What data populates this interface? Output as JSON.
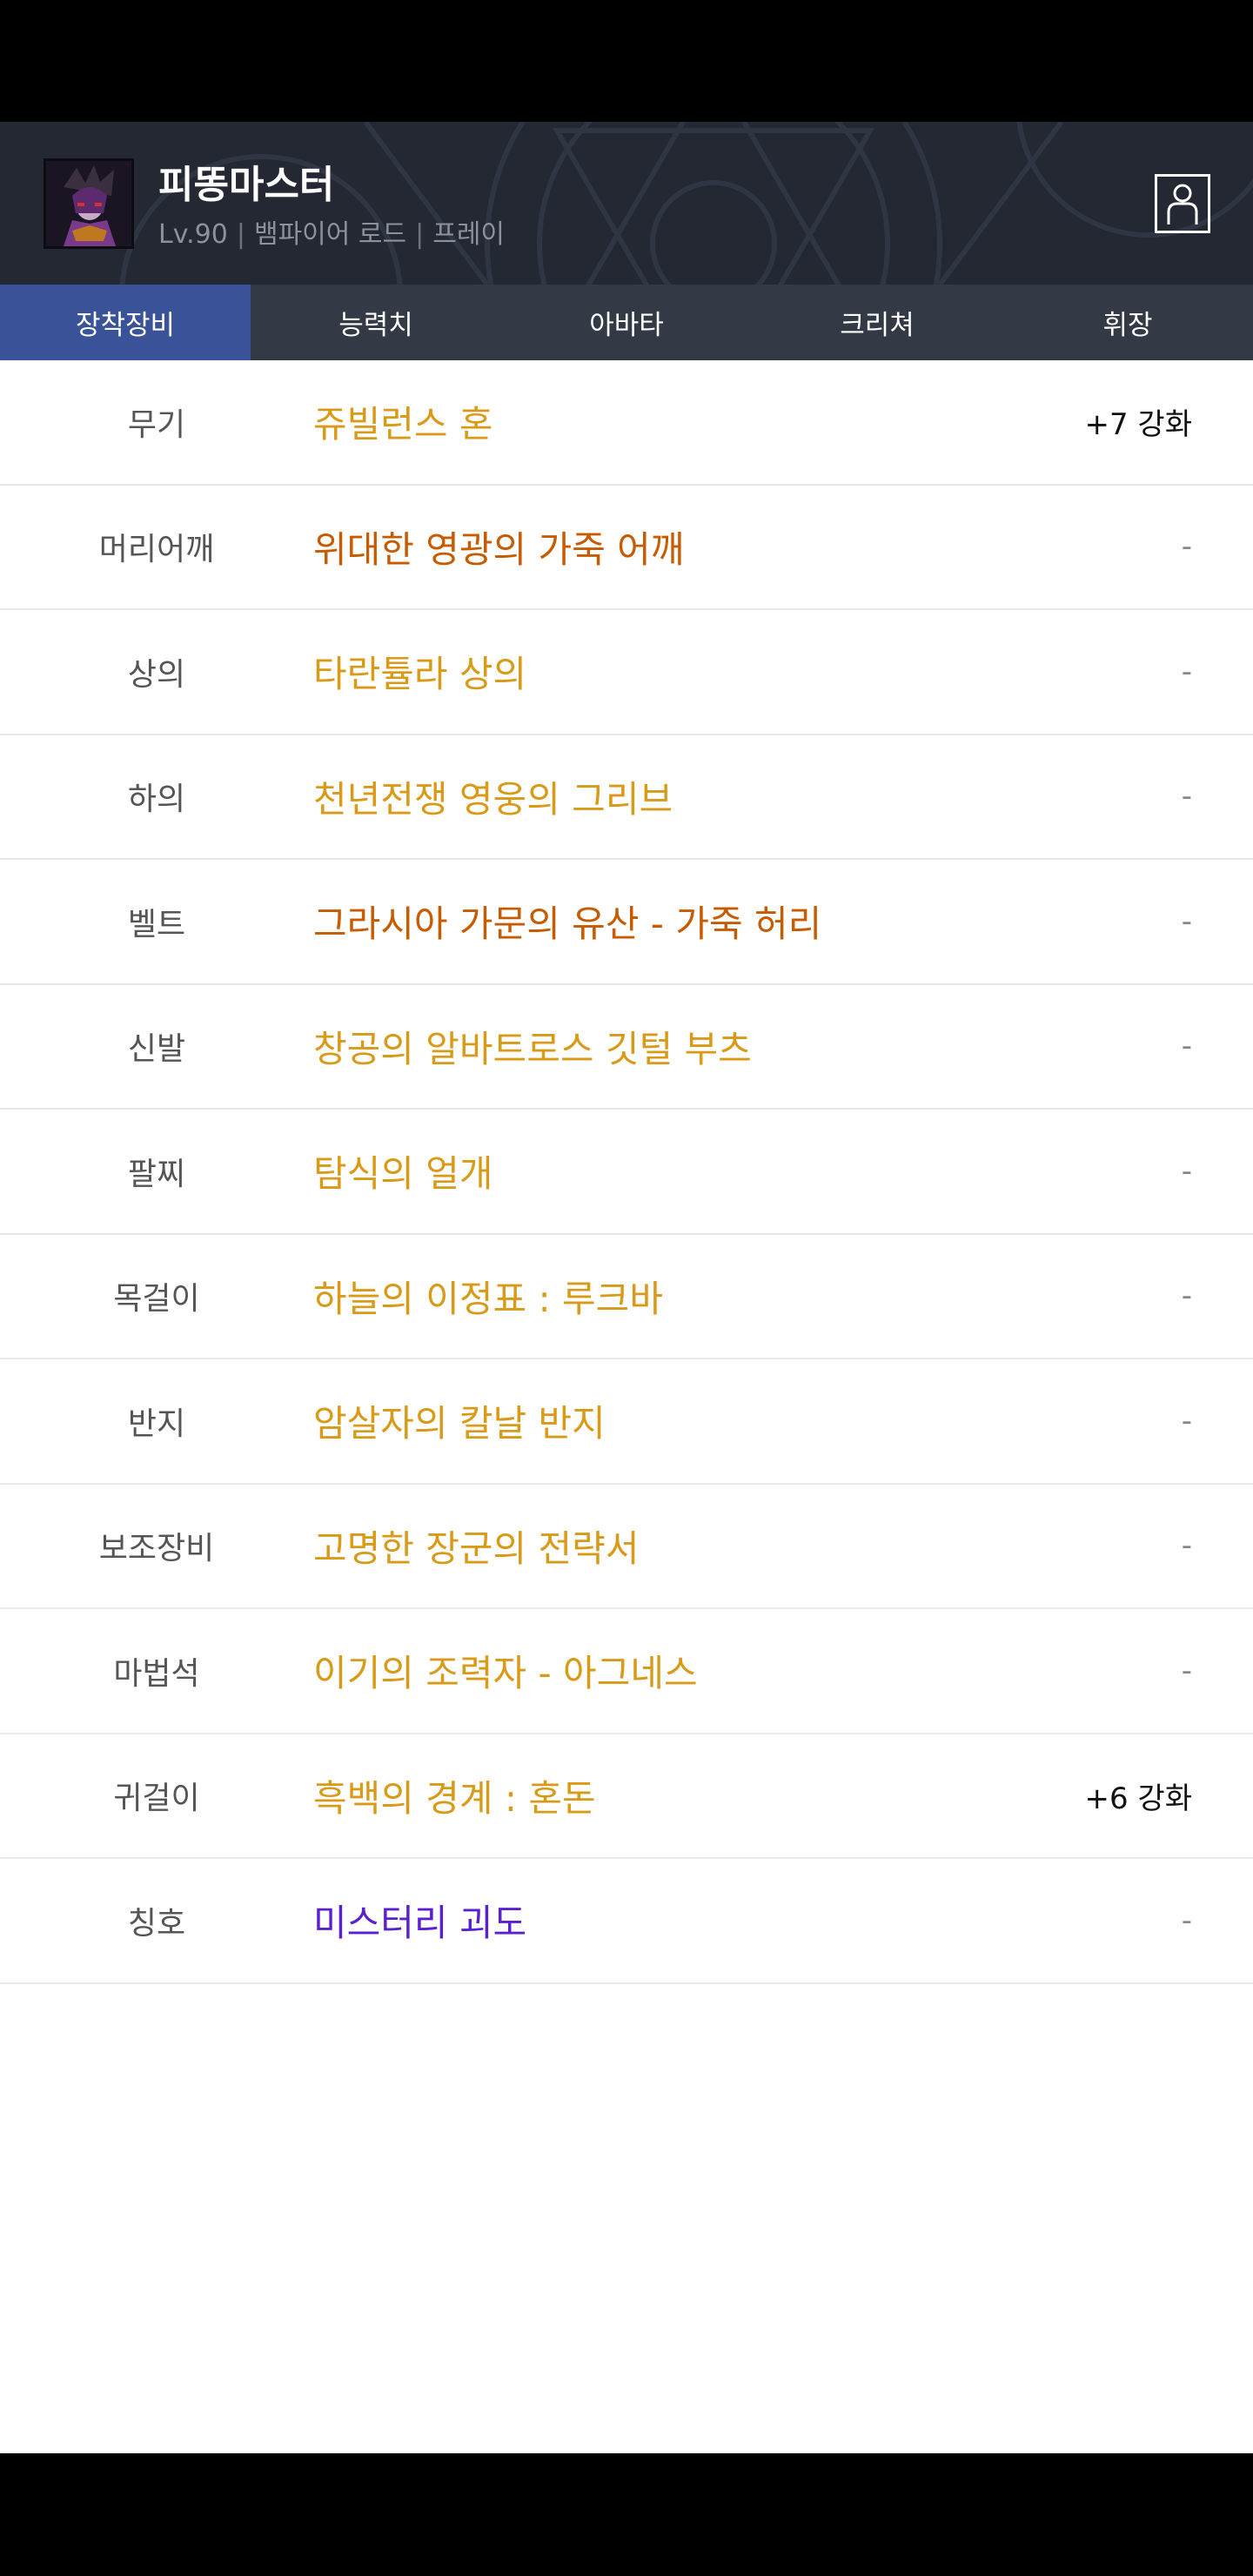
{
  "profile": {
    "name": "피똥마스터",
    "level": "Lv.90",
    "job": "뱀파이어 로드",
    "server": "프레이"
  },
  "tabs": [
    {
      "label": "장착장비",
      "active": true
    },
    {
      "label": "능력치"
    },
    {
      "label": "아바타"
    },
    {
      "label": "크리쳐"
    },
    {
      "label": "휘장"
    }
  ],
  "colors": {
    "gold": "#d99a18",
    "orange": "#c75b00",
    "purple": "#5a1fcf",
    "tab_active": "#3a5398",
    "tab_bar": "#333945"
  },
  "equipment": [
    {
      "slot": "무기",
      "item": "쥬빌런스 혼",
      "enhance": "+7 강화",
      "color": "#d99a18"
    },
    {
      "slot": "머리어깨",
      "item": "위대한 영광의 가죽 어깨",
      "enhance": "-",
      "color": "#c75b00"
    },
    {
      "slot": "상의",
      "item": "타란튤라 상의",
      "enhance": "-",
      "color": "#d99a18"
    },
    {
      "slot": "하의",
      "item": "천년전쟁 영웅의 그리브",
      "enhance": "-",
      "color": "#d99a18"
    },
    {
      "slot": "벨트",
      "item": "그라시아 가문의 유산 - 가죽 허리",
      "enhance": "-",
      "color": "#c75b00"
    },
    {
      "slot": "신발",
      "item": "창공의 알바트로스 깃털 부츠",
      "enhance": "-",
      "color": "#d99a18"
    },
    {
      "slot": "팔찌",
      "item": "탐식의 얼개",
      "enhance": "-",
      "color": "#d99a18"
    },
    {
      "slot": "목걸이",
      "item": "하늘의 이정표 : 루크바",
      "enhance": "-",
      "color": "#d99a18"
    },
    {
      "slot": "반지",
      "item": "암살자의 칼날 반지",
      "enhance": "-",
      "color": "#d99a18"
    },
    {
      "slot": "보조장비",
      "item": "고명한 장군의 전략서",
      "enhance": "-",
      "color": "#d99a18"
    },
    {
      "slot": "마법석",
      "item": "이기의 조력자 - 아그네스",
      "enhance": "-",
      "color": "#d99a18"
    },
    {
      "slot": "귀걸이",
      "item": "흑백의 경계 : 혼돈",
      "enhance": "+6 강화",
      "color": "#d99a18"
    },
    {
      "slot": "칭호",
      "item": "미스터리 괴도",
      "enhance": "-",
      "color": "#5a1fcf"
    }
  ]
}
